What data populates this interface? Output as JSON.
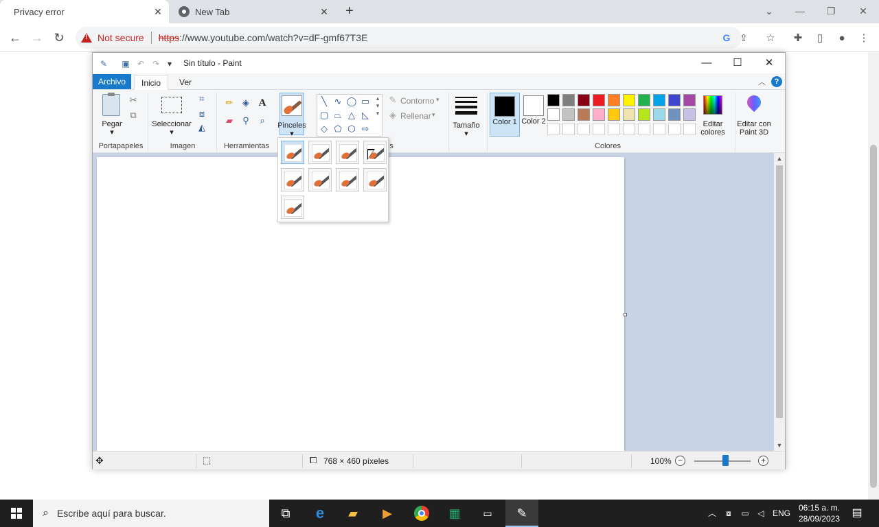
{
  "browser": {
    "tabs": [
      {
        "label": "Privacy error",
        "active": true
      },
      {
        "label": "New Tab",
        "active": false
      }
    ],
    "security_label": "Not secure",
    "url_scheme": "https",
    "url_rest": "://www.youtube.com/watch?v=dF-gmf67T3E"
  },
  "paint": {
    "title": "Sin título - Paint",
    "ribbon_tabs": [
      "Archivo",
      "Inicio",
      "Ver"
    ],
    "help_label": "?",
    "groups": {
      "clipboard": "Portapapeles",
      "image": "Imagen",
      "tools": "Herramientas",
      "colors": "Colores"
    },
    "buttons": {
      "paste": "Pegar",
      "select": "Seleccionar",
      "brushes": "Pinceles",
      "outline": "Contorno",
      "fill": "Rellenar",
      "size": "Tamaño",
      "color1": "Color 1",
      "color2": "Color 2",
      "edit_colors": "Editar colores",
      "edit_paint3d": "Editar con Paint 3D"
    },
    "group_label_partial": "s",
    "palette_row1": [
      "#000000",
      "#7f7f7f",
      "#880015",
      "#ed1c24",
      "#ff7f27",
      "#fff200",
      "#22b14c",
      "#00a2e8",
      "#3f48cc",
      "#a349a4"
    ],
    "palette_row2": [
      "#ffffff",
      "#c3c3c3",
      "#b97a57",
      "#ffaec9",
      "#ffc90e",
      "#efe4b0",
      "#b5e61d",
      "#99d9ea",
      "#7092be",
      "#c8bfe7"
    ],
    "color1_value": "#000000",
    "color2_value": "#ffffff",
    "status": {
      "dimensions": "768 × 460 píxeles",
      "zoom": "100%",
      "zoom_level": 0.55
    }
  },
  "taskbar": {
    "search_placeholder": "Escribe aquí para buscar.",
    "language": "ENG",
    "time": "06:15 a. m.",
    "date": "28/09/2023"
  }
}
